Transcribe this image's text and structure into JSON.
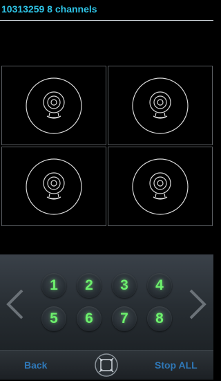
{
  "header": {
    "title": "10313259  8 channels"
  },
  "grid": {
    "cells": [
      {
        "icon": "webcam-icon"
      },
      {
        "icon": "webcam-icon"
      },
      {
        "icon": "webcam-icon"
      },
      {
        "icon": "webcam-icon"
      }
    ]
  },
  "controls": {
    "channels": [
      "1",
      "2",
      "3",
      "4",
      "5",
      "6",
      "7",
      "8"
    ],
    "prev_icon": "chevron-left-icon",
    "next_icon": "chevron-right-icon"
  },
  "bottom_bar": {
    "back_label": "Back",
    "stop_label": "Stop ALL",
    "fullscreen_icon": "fullscreen-icon"
  },
  "colors": {
    "header_text": "#2ec4e6",
    "channel_text": "#6df06d",
    "bar_text": "#2f78b8"
  }
}
